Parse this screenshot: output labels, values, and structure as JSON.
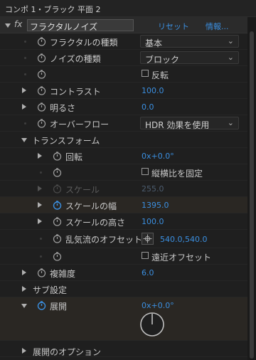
{
  "window": {
    "title": "コンポ 1・ブラック 平面 2"
  },
  "effect": {
    "fx_label": "fx",
    "name": "フラクタルノイズ",
    "reset_label": "リセット",
    "info_label": "情報..."
  },
  "props": {
    "fractal_type": {
      "label": "フラクタルの種類",
      "value": "基本"
    },
    "noise_type": {
      "label": "ノイズの種類",
      "value": "ブロック"
    },
    "invert": {
      "label": "反転"
    },
    "contrast": {
      "label": "コントラスト",
      "value": "100.0"
    },
    "brightness": {
      "label": "明るさ",
      "value": "0.0"
    },
    "overflow": {
      "label": "オーバーフロー",
      "value": "HDR 効果を使用"
    },
    "transform": {
      "label": "トランスフォーム"
    },
    "rotation": {
      "label": "回転",
      "value": "0x+0.0°"
    },
    "uniform_scale": {
      "label": "縦横比を固定"
    },
    "scale": {
      "label": "スケール",
      "value": "255.0"
    },
    "scale_width": {
      "label": "スケールの幅",
      "value": "1395.0"
    },
    "scale_height": {
      "label": "スケールの高さ",
      "value": "100.0"
    },
    "offset": {
      "label": "乱気流のオフセット",
      "value": "540.0,540.0"
    },
    "perspective_offset": {
      "label": "遠近オフセット"
    },
    "complexity": {
      "label": "複雑度",
      "value": "6.0"
    },
    "sub_settings": {
      "label": "サブ設定"
    },
    "evolution": {
      "label": "展開",
      "value": "0x+0.0°"
    },
    "evolution_options": {
      "label": "展開のオプション"
    }
  },
  "colors": {
    "accent": "#3b8fe0",
    "highlight_row": "#2a2723"
  }
}
